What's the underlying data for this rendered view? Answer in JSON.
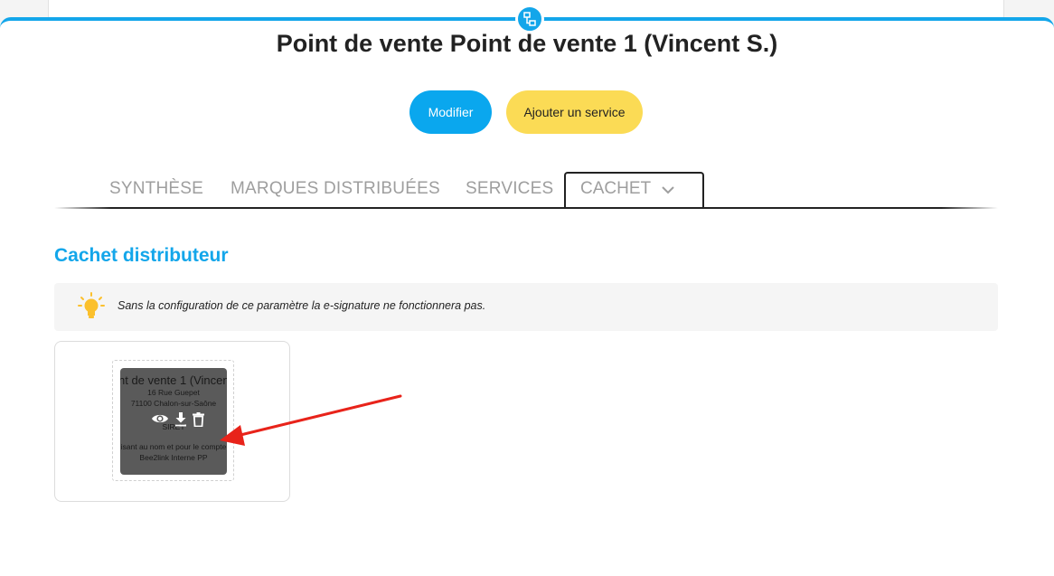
{
  "header": {
    "title": "Point de vente Point de vente 1 (Vincent S.)",
    "top_icon": "network-icon"
  },
  "actions": {
    "modifier_label": "Modifier",
    "ajouter_label": "Ajouter un service"
  },
  "tabs": [
    {
      "label": "SYNTHÈSE",
      "active": false
    },
    {
      "label": "MARQUES DISTRIBUÉES",
      "active": false
    },
    {
      "label": "SERVICES",
      "active": false
    },
    {
      "label": "CACHET",
      "active": true,
      "icon": "chevron-down-icon"
    }
  ],
  "section": {
    "title": "Cachet distributeur",
    "info_icon": "lightbulb-icon",
    "info_text": "Sans la configuration de ce paramètre la e-signature ne fonctionnera pas."
  },
  "stamp": {
    "line1": "nt de vente 1 (Vincent",
    "line2": "16 Rue Guepet",
    "line3": "71100 Chalon-sur-Saône",
    "line4": "SIRET",
    "line5": "isant au nom et pour le compte",
    "line6": "Bee2link Interne PP",
    "actions": [
      "eye-icon",
      "download-icon",
      "trash-icon"
    ]
  },
  "colors": {
    "accent": "#13a6ea",
    "primary_button": "#0aa7ee",
    "secondary_button": "#fbdb55",
    "annotation_arrow": "#e8231a"
  }
}
